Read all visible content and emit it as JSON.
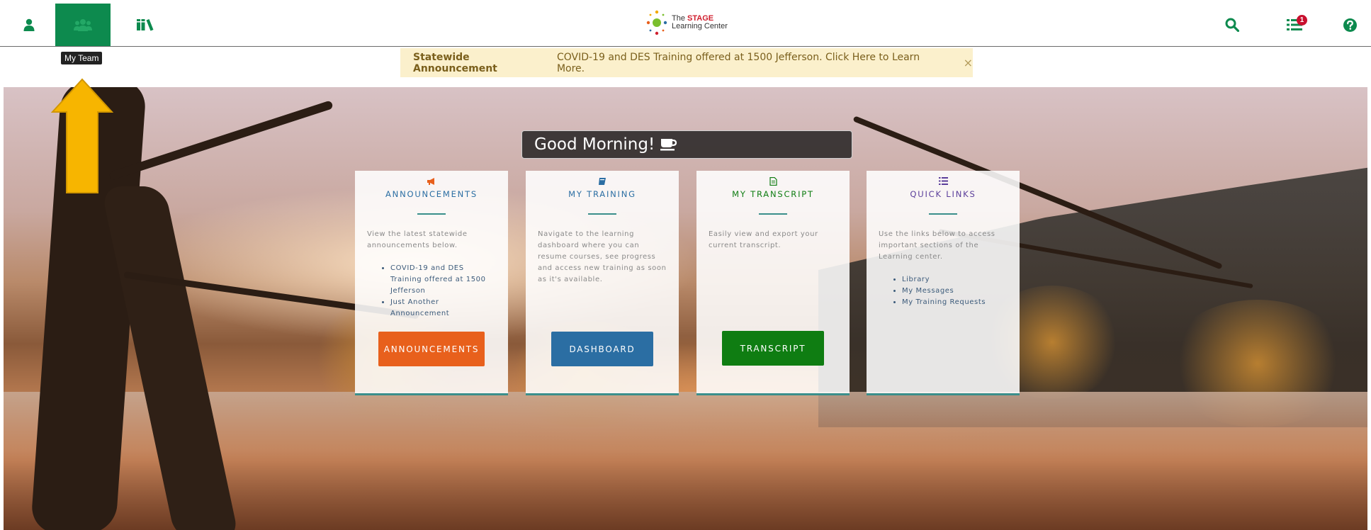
{
  "nav": {
    "tooltip": "My Team",
    "logo": {
      "line1_pre": "The ",
      "line1_brand": "STAGE",
      "line2": "Learning Center"
    },
    "notification_count": "1"
  },
  "announcement_bar": {
    "label": "Statewide Announcement",
    "text": "COVID-19 and DES Training offered at 1500 Jefferson. Click Here to Learn More.",
    "close": "×"
  },
  "greeting": {
    "text": "Good Morning!"
  },
  "cards": [
    {
      "title": "ANNOUNCEMENTS",
      "description": "View the latest statewide announcements below.",
      "items": [
        "COVID-19 and DES Training offered at 1500 Jefferson",
        "Just Another Announcement"
      ],
      "button": "ANNOUNCEMENTS",
      "color": "#e8601c"
    },
    {
      "title": "MY TRAINING",
      "description": "Navigate to the learning dashboard where you can resume courses, see progress and access new training as soon as it's available.",
      "button": "DASHBOARD",
      "color": "#2b6ea3"
    },
    {
      "title": "MY TRANSCRIPT",
      "description": "Easily view and export your current transcript.",
      "button": "TRANSCRIPT",
      "color": "#0f7d12"
    },
    {
      "title": "QUICK LINKS",
      "description": "Use the links below to access important sections of the Learning center.",
      "items": [
        "Library",
        "My Messages",
        "My Training Requests"
      ],
      "color": "#5a3d9a"
    }
  ],
  "colors": {
    "brand_green": "#0d8a4e",
    "arrow": "#f7b500",
    "teal": "#3a8f8b"
  }
}
